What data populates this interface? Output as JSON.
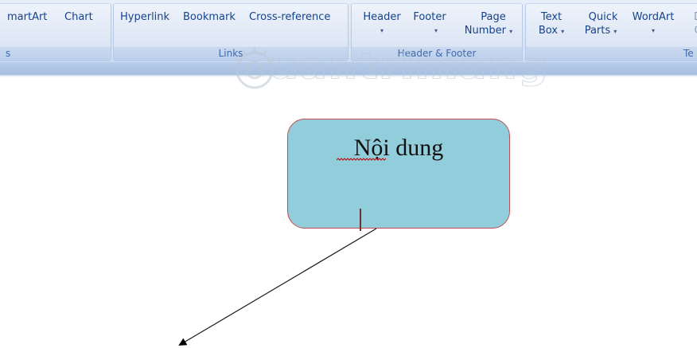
{
  "ribbon": {
    "groups": {
      "illustrations": {
        "label": "s",
        "buttons": {
          "smartart": "martArt",
          "chart": "Chart"
        }
      },
      "links": {
        "label": "Links",
        "buttons": {
          "hyperlink": "Hyperlink",
          "bookmark": "Bookmark",
          "cross_reference": "Cross-reference"
        }
      },
      "header_footer": {
        "label": "Header & Footer",
        "buttons": {
          "header": "Header",
          "footer": "Footer",
          "page_number_line1": "Page",
          "page_number_line2": "Number",
          "dropdown_glyph": "▾"
        }
      },
      "text": {
        "label": "Te",
        "buttons": {
          "text_box_line1": "Text",
          "text_box_line2": "Box",
          "quick_parts_line1": "Quick",
          "quick_parts_line2": "Parts",
          "wordart": "WordArt",
          "dropcap_partial_line1": "D",
          "dropcap_partial_line2": "C"
        }
      }
    }
  },
  "watermark": {
    "text": "uantrimang"
  },
  "document": {
    "shape_text": "Nội dung",
    "colors": {
      "shape_fill": "#92cddc",
      "shape_border": "#c0504d",
      "spellcheck": "#c00000"
    }
  }
}
